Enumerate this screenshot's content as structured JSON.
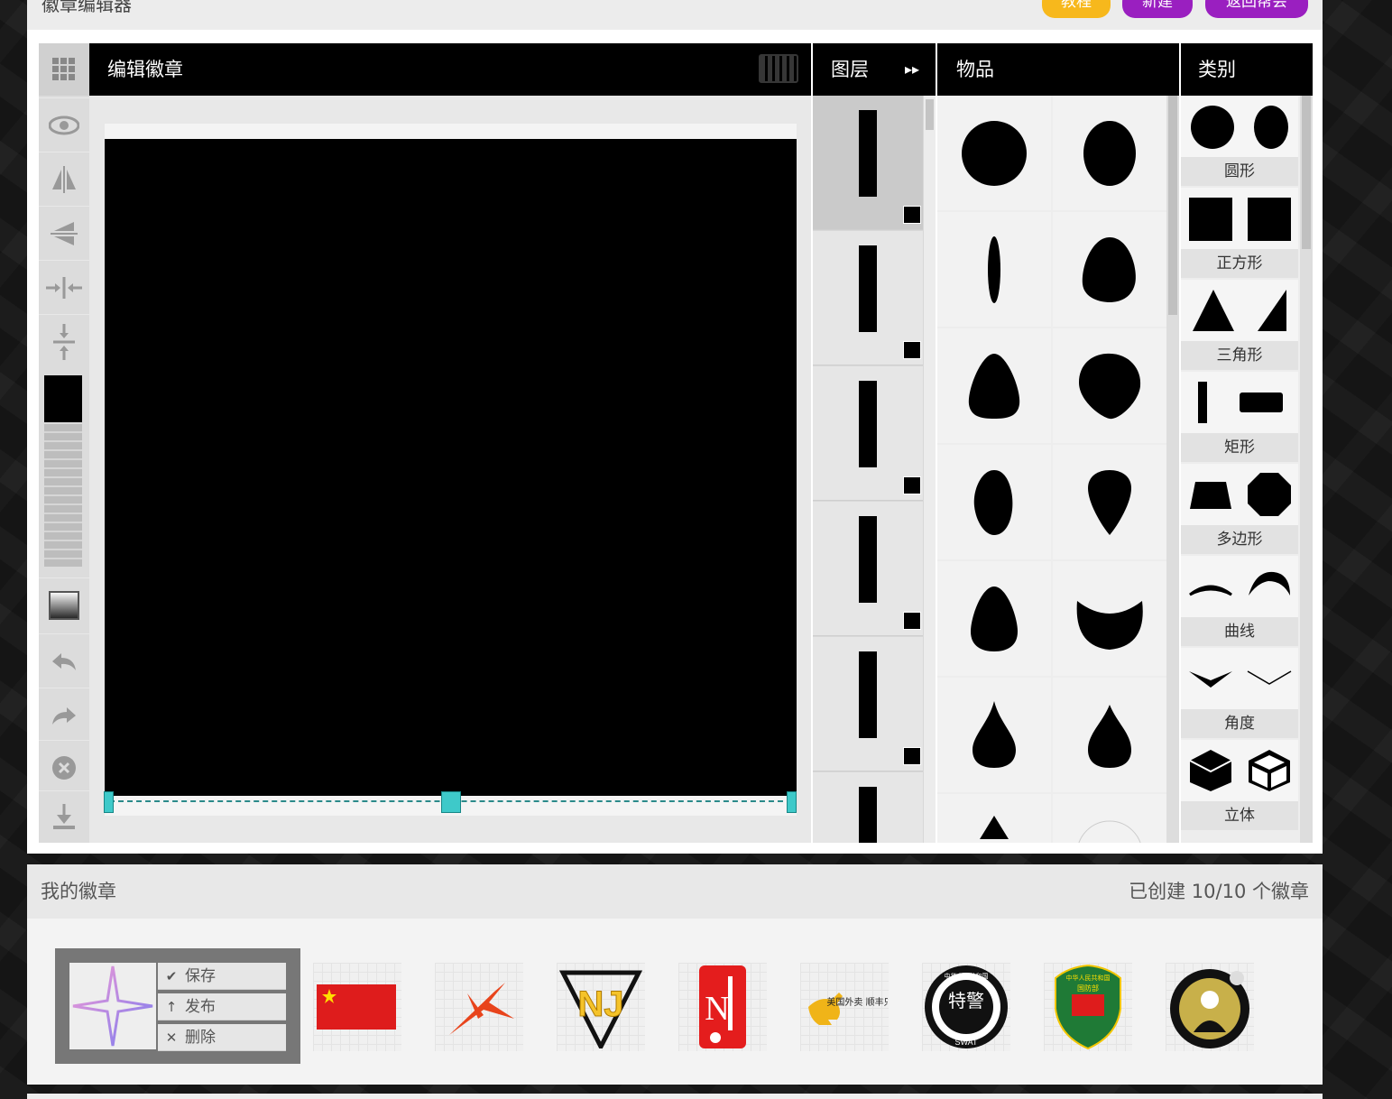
{
  "app": {
    "title": "徽章编辑器",
    "buttons": {
      "tutorial": "教程",
      "new": "新建",
      "back": "返回帮会"
    }
  },
  "editor": {
    "title": "编辑徽章",
    "fill_color": "#000000",
    "handle_color": "#3ec9c9"
  },
  "left_tools": [
    "grid-icon",
    "eye-icon",
    "flip-horizontal-icon",
    "flip-vertical-icon",
    "shrink-horizontal-icon",
    "shrink-vertical-icon",
    "color-swatch",
    "gradient-icon",
    "undo-icon",
    "redo-icon",
    "delete-icon",
    "download-icon"
  ],
  "layers": {
    "title": "图层",
    "count_visible": 6
  },
  "items": {
    "title": "物品"
  },
  "categories": {
    "title": "类别",
    "list": [
      "圆形",
      "正方形",
      "三角形",
      "矩形",
      "多边形",
      "曲线",
      "角度",
      "立体"
    ]
  },
  "my_badges": {
    "title": "我的徽章",
    "count_text": "已创建 10/10 个徽章",
    "actions": {
      "save": "保存",
      "publish": "发布",
      "delete": "删除"
    },
    "badges": [
      "star-badge",
      "china-flag-badge",
      "red-x-badge",
      "nj-triangle-badge",
      "red-n-scroll-badge",
      "kangaroo-badge",
      "swat-badge",
      "national-defense-badge",
      "anonymous-badge"
    ],
    "badge_texts": {
      "kangaroo": "美国外卖 顺丰只送",
      "swat_main": "特警",
      "swat_top": "中华人民共和国",
      "swat_bottom": "SWAT",
      "defense_top": "中华人民共和国",
      "defense_sub": "国防部"
    }
  }
}
